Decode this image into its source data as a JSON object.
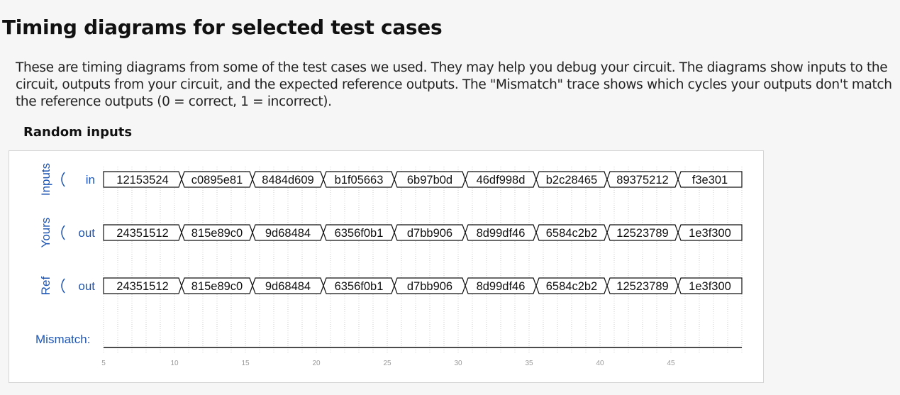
{
  "page": {
    "title": "Timing diagrams for selected test cases",
    "intro": "These are timing diagrams from some of the test cases we used. They may help you debug your circuit. The diagrams show inputs to the circuit, outputs from your circuit, and the expected reference outputs. The \"Mismatch\" trace shows which cycles your outputs don't match the reference outputs (0 = correct, 1 = incorrect).",
    "section_title": "Random inputs"
  },
  "diagram": {
    "groups": [
      {
        "group_label": "Inputs",
        "signal_label": "in",
        "values": [
          "12153524",
          "c0895e81",
          "8484d609",
          "b1f05663",
          "6b97b0d",
          "46df998d",
          "b2c28465",
          "89375212",
          "f3e301"
        ]
      },
      {
        "group_label": "Yours",
        "signal_label": "out",
        "values": [
          "24351512",
          "815e89c0",
          "9d68484",
          "6356f0b1",
          "d7bb906",
          "8d99df46",
          "6584c2b2",
          "12523789",
          "1e3f300"
        ]
      },
      {
        "group_label": "Ref",
        "signal_label": "out",
        "values": [
          "24351512",
          "815e89c0",
          "9d68484",
          "6356f0b1",
          "d7bb906",
          "8d99df46",
          "6584c2b2",
          "12523789",
          "1e3f300"
        ]
      }
    ],
    "mismatch_label": "Mismatch:",
    "mismatch_value": 0,
    "segment_starts": [
      5,
      10.5,
      15.5,
      20.5,
      25.5,
      30.5,
      35.5,
      40.5,
      45.5
    ],
    "time_end": 50,
    "ticks": [
      5,
      10,
      15,
      20,
      25,
      30,
      35,
      40,
      45
    ],
    "colors": {
      "label": "#1e55b3",
      "trace": "#111111",
      "grid": "#cccccc",
      "tick": "#999999"
    }
  }
}
